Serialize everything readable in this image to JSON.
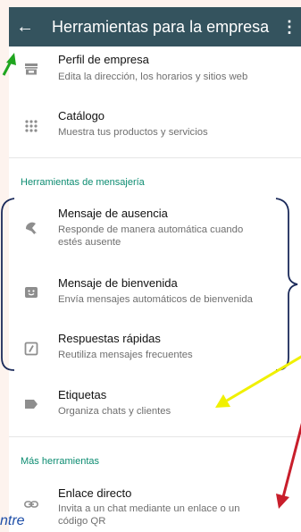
{
  "appbar": {
    "title": "Herramientas para la empresa",
    "back_icon": "arrow-back-icon",
    "more_icon": "more-vert-icon"
  },
  "items": {
    "business_profile": {
      "title": "Perfil de empresa",
      "subtitle": "Edita la dirección, los horarios y sitios web",
      "icon": "store-icon"
    },
    "catalog": {
      "title": "Catálogo",
      "subtitle": "Muestra tus productos y servicios",
      "icon": "grid-icon"
    },
    "away_message": {
      "title": "Mensaje de ausencia",
      "subtitle_line1": "Responde de manera automática cuando",
      "subtitle_line2": "estés ausente",
      "icon": "moon-icon"
    },
    "greeting_message": {
      "title": "Mensaje de bienvenida",
      "subtitle": "Envía mensajes automáticos de bienvenida",
      "icon": "greeting-icon"
    },
    "quick_replies": {
      "title": "Respuestas rápidas",
      "subtitle": "Reutiliza mensajes frecuentes",
      "icon": "quick-reply-icon"
    },
    "labels": {
      "title": "Etiquetas",
      "subtitle": "Organiza chats y clientes",
      "icon": "label-icon"
    },
    "short_link": {
      "title": "Enlace directo",
      "subtitle_line1": "Invita a un chat mediante un enlace o un",
      "subtitle_line2": "código QR",
      "icon": "link-icon"
    }
  },
  "sections": {
    "messaging_tools": "Herramientas de mensajería",
    "more_tools": "Más herramientas"
  },
  "annotations": {
    "watermark_text": "ntre",
    "colors": {
      "green_arrow": "#1fa51f",
      "yellow_arrow": "#f0f000",
      "red_arrow": "#c81e2b",
      "brace": "#1b2a5a"
    }
  },
  "colors": {
    "appbar": "#34535e",
    "accent": "#0c8c71",
    "background": "#fdf3ee"
  }
}
